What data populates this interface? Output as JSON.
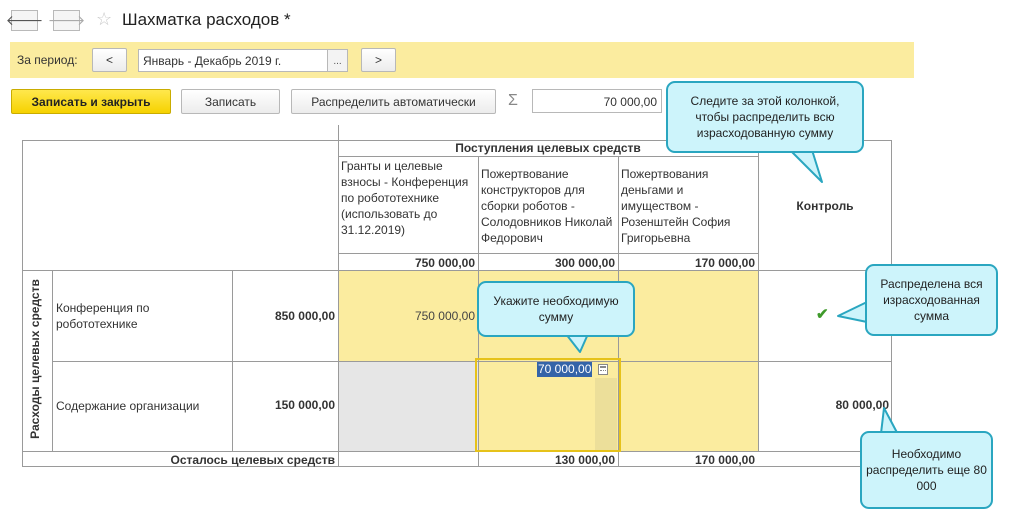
{
  "window": {
    "title": "Шахматка расходов *",
    "nav_back_icon": "arrow-left-icon",
    "nav_forward_icon": "arrow-right-icon",
    "favorite_icon": "star-icon"
  },
  "period": {
    "label": "За период:",
    "prev": "<",
    "value": "Январь - Декабрь 2019 г.",
    "choose": "...",
    "next": ">"
  },
  "toolbar": {
    "save_close": "Записать и закрыть",
    "save": "Записать",
    "distribute": "Распределить автоматически",
    "sum_icon": "Σ",
    "sum_value": "70 000,00"
  },
  "grid": {
    "group_header": "Поступления целевых средств",
    "columns": [
      {
        "header": "Гранты и целевые взносы - Конференция по робототехнике (использовать до 31.12.2019)",
        "total": "750 000,00",
        "remaining": ""
      },
      {
        "header": "Пожертвование конструкторов для сборки роботов - Солодовников Николай Федорович",
        "total": "300 000,00",
        "remaining": "130 000,00"
      },
      {
        "header": "Пожертвования деньгами и имуществом - Розенштейн София Григорьевна",
        "total": "170 000,00",
        "remaining": "170 000,00"
      }
    ],
    "control_header": "Контроль",
    "rows_group_label": "Расходы целевых средств",
    "rows": [
      {
        "name": "Конференция по робототехнике",
        "amount": "850 000,00",
        "cells": [
          "750 000,00",
          "",
          ""
        ],
        "control": "✔"
      },
      {
        "name": "Содержание организации",
        "amount": "150 000,00",
        "cells": [
          "",
          "70 000,00",
          ""
        ],
        "control": "80 000,00"
      }
    ],
    "remaining_label": "Осталось целевых средств",
    "edit_icon": "calculator-icon"
  },
  "callouts": {
    "watch_column": "Следите за этой колонкой, чтобы распределить всю израсходованную сумму",
    "enter_amount": "Укажите необходимую сумму",
    "distributed": "Распределена вся израсходованная сумма",
    "need_distribute": "Необходимо распределить еще 80 000"
  },
  "colors": {
    "yellow": "#fbec9f",
    "callout_bg": "#cdf4fb",
    "callout_border": "#2aa6c0",
    "check": "#3f9a2b",
    "selection": "#3464a8"
  }
}
